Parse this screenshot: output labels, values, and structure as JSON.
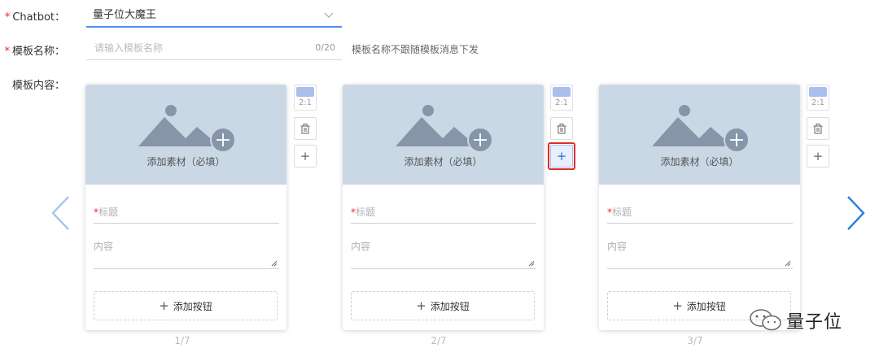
{
  "form": {
    "chatbot_label": "Chatbot：",
    "chatbot_value": "量子位大魔王",
    "name_label": "模板名称：",
    "name_placeholder": "请输入模板名称",
    "name_value": "",
    "name_count": "0/20",
    "name_hint": "模板名称不跟随模板消息下发",
    "content_label": "模板内容："
  },
  "required_mark": "*",
  "cards": [
    {
      "media_label": "添加素材（必填）",
      "title_placeholder": "标题",
      "content_placeholder": "内容",
      "add_button_label": "添加按钮",
      "ratio": "2:1",
      "page": "1/7"
    },
    {
      "media_label": "添加素材（必填）",
      "title_placeholder": "标题",
      "content_placeholder": "内容",
      "add_button_label": "添加按钮",
      "ratio": "2:1",
      "page": "2/7"
    },
    {
      "media_label": "添加素材（必填）",
      "title_placeholder": "标题",
      "content_placeholder": "内容",
      "add_button_label": "添加按钮",
      "ratio": "2:1",
      "page": "3/7"
    }
  ],
  "icons": {
    "plus": "+",
    "trash": "trash-icon",
    "prev": "chevron-left-icon",
    "next": "chevron-right-icon",
    "dropdown": "chevron-down-icon"
  },
  "colors": {
    "accent": "#4d8df0",
    "required": "#f5222d",
    "media_bg": "#cad8e6",
    "highlight": "#d9302a",
    "ratio_swatch": "#a9c0ef"
  },
  "watermark": {
    "text": "量子位"
  }
}
